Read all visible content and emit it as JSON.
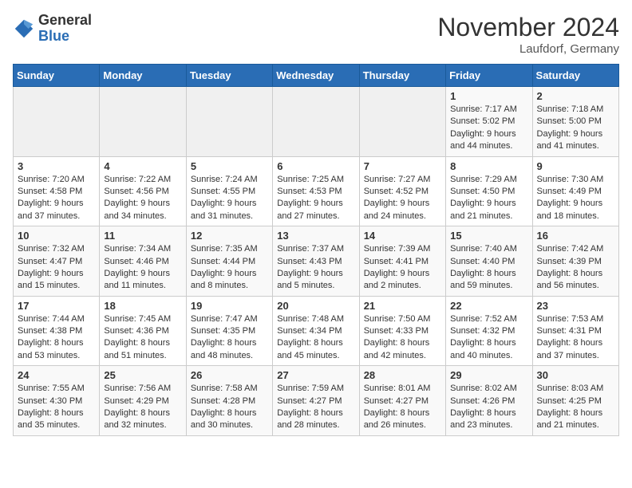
{
  "header": {
    "logo_general": "General",
    "logo_blue": "Blue",
    "month_title": "November 2024",
    "location": "Laufdorf, Germany"
  },
  "days_of_week": [
    "Sunday",
    "Monday",
    "Tuesday",
    "Wednesday",
    "Thursday",
    "Friday",
    "Saturday"
  ],
  "weeks": [
    [
      {
        "day": "",
        "info": ""
      },
      {
        "day": "",
        "info": ""
      },
      {
        "day": "",
        "info": ""
      },
      {
        "day": "",
        "info": ""
      },
      {
        "day": "",
        "info": ""
      },
      {
        "day": "1",
        "info": "Sunrise: 7:17 AM\nSunset: 5:02 PM\nDaylight: 9 hours and 44 minutes."
      },
      {
        "day": "2",
        "info": "Sunrise: 7:18 AM\nSunset: 5:00 PM\nDaylight: 9 hours and 41 minutes."
      }
    ],
    [
      {
        "day": "3",
        "info": "Sunrise: 7:20 AM\nSunset: 4:58 PM\nDaylight: 9 hours and 37 minutes."
      },
      {
        "day": "4",
        "info": "Sunrise: 7:22 AM\nSunset: 4:56 PM\nDaylight: 9 hours and 34 minutes."
      },
      {
        "day": "5",
        "info": "Sunrise: 7:24 AM\nSunset: 4:55 PM\nDaylight: 9 hours and 31 minutes."
      },
      {
        "day": "6",
        "info": "Sunrise: 7:25 AM\nSunset: 4:53 PM\nDaylight: 9 hours and 27 minutes."
      },
      {
        "day": "7",
        "info": "Sunrise: 7:27 AM\nSunset: 4:52 PM\nDaylight: 9 hours and 24 minutes."
      },
      {
        "day": "8",
        "info": "Sunrise: 7:29 AM\nSunset: 4:50 PM\nDaylight: 9 hours and 21 minutes."
      },
      {
        "day": "9",
        "info": "Sunrise: 7:30 AM\nSunset: 4:49 PM\nDaylight: 9 hours and 18 minutes."
      }
    ],
    [
      {
        "day": "10",
        "info": "Sunrise: 7:32 AM\nSunset: 4:47 PM\nDaylight: 9 hours and 15 minutes."
      },
      {
        "day": "11",
        "info": "Sunrise: 7:34 AM\nSunset: 4:46 PM\nDaylight: 9 hours and 11 minutes."
      },
      {
        "day": "12",
        "info": "Sunrise: 7:35 AM\nSunset: 4:44 PM\nDaylight: 9 hours and 8 minutes."
      },
      {
        "day": "13",
        "info": "Sunrise: 7:37 AM\nSunset: 4:43 PM\nDaylight: 9 hours and 5 minutes."
      },
      {
        "day": "14",
        "info": "Sunrise: 7:39 AM\nSunset: 4:41 PM\nDaylight: 9 hours and 2 minutes."
      },
      {
        "day": "15",
        "info": "Sunrise: 7:40 AM\nSunset: 4:40 PM\nDaylight: 8 hours and 59 minutes."
      },
      {
        "day": "16",
        "info": "Sunrise: 7:42 AM\nSunset: 4:39 PM\nDaylight: 8 hours and 56 minutes."
      }
    ],
    [
      {
        "day": "17",
        "info": "Sunrise: 7:44 AM\nSunset: 4:38 PM\nDaylight: 8 hours and 53 minutes."
      },
      {
        "day": "18",
        "info": "Sunrise: 7:45 AM\nSunset: 4:36 PM\nDaylight: 8 hours and 51 minutes."
      },
      {
        "day": "19",
        "info": "Sunrise: 7:47 AM\nSunset: 4:35 PM\nDaylight: 8 hours and 48 minutes."
      },
      {
        "day": "20",
        "info": "Sunrise: 7:48 AM\nSunset: 4:34 PM\nDaylight: 8 hours and 45 minutes."
      },
      {
        "day": "21",
        "info": "Sunrise: 7:50 AM\nSunset: 4:33 PM\nDaylight: 8 hours and 42 minutes."
      },
      {
        "day": "22",
        "info": "Sunrise: 7:52 AM\nSunset: 4:32 PM\nDaylight: 8 hours and 40 minutes."
      },
      {
        "day": "23",
        "info": "Sunrise: 7:53 AM\nSunset: 4:31 PM\nDaylight: 8 hours and 37 minutes."
      }
    ],
    [
      {
        "day": "24",
        "info": "Sunrise: 7:55 AM\nSunset: 4:30 PM\nDaylight: 8 hours and 35 minutes."
      },
      {
        "day": "25",
        "info": "Sunrise: 7:56 AM\nSunset: 4:29 PM\nDaylight: 8 hours and 32 minutes."
      },
      {
        "day": "26",
        "info": "Sunrise: 7:58 AM\nSunset: 4:28 PM\nDaylight: 8 hours and 30 minutes."
      },
      {
        "day": "27",
        "info": "Sunrise: 7:59 AM\nSunset: 4:27 PM\nDaylight: 8 hours and 28 minutes."
      },
      {
        "day": "28",
        "info": "Sunrise: 8:01 AM\nSunset: 4:27 PM\nDaylight: 8 hours and 26 minutes."
      },
      {
        "day": "29",
        "info": "Sunrise: 8:02 AM\nSunset: 4:26 PM\nDaylight: 8 hours and 23 minutes."
      },
      {
        "day": "30",
        "info": "Sunrise: 8:03 AM\nSunset: 4:25 PM\nDaylight: 8 hours and 21 minutes."
      }
    ]
  ]
}
